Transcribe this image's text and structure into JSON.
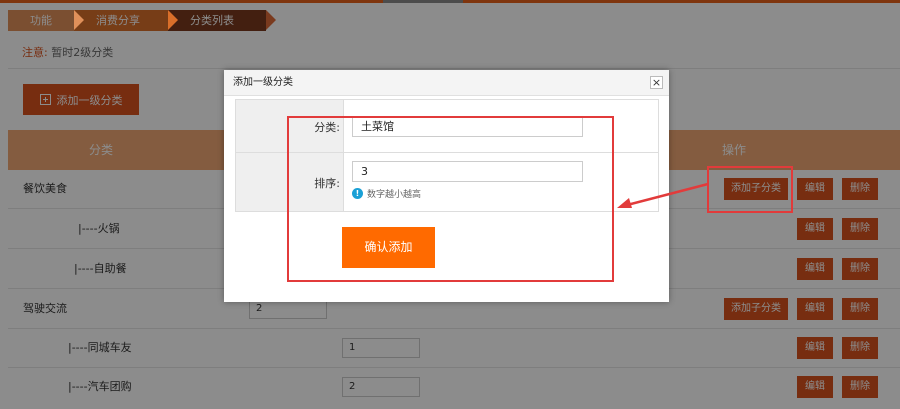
{
  "breadcrumb": [
    "功能",
    "消费分享",
    "分类列表"
  ],
  "notice": {
    "label": "注意:",
    "text": "暂时2级分类"
  },
  "add_button": "添加一级分类",
  "table": {
    "headers": {
      "category": "分类",
      "operations": "操作"
    },
    "rows": [
      {
        "name": "餐饮美食",
        "sort": "",
        "ops": [
          "添加子分类",
          "编辑",
          "删除"
        ]
      },
      {
        "name": "|----火锅",
        "sort": "",
        "ops": [
          "编辑",
          "删除"
        ]
      },
      {
        "name": "|----自助餐",
        "sort": "",
        "ops": [
          "编辑",
          "删除"
        ]
      },
      {
        "name": "驾驶交流",
        "sort": "2",
        "ops": [
          "添加子分类",
          "编辑",
          "删除"
        ]
      },
      {
        "name": "|----同城车友",
        "sort": "1",
        "ops": [
          "编辑",
          "删除"
        ]
      },
      {
        "name": "|----汽车团购",
        "sort": "2",
        "ops": [
          "编辑",
          "删除"
        ]
      }
    ]
  },
  "modal": {
    "title": "添加一级分类",
    "close": "×",
    "category_label": "分类:",
    "category_value": "土菜馆",
    "sort_label": "排序:",
    "sort_value": "3",
    "hint": "数字越小越高",
    "confirm": "确认添加"
  },
  "colors": {
    "accent": "#d9531e",
    "confirm": "#ff6a00",
    "header": "#f0a875",
    "annotation": "#e23b3b"
  }
}
